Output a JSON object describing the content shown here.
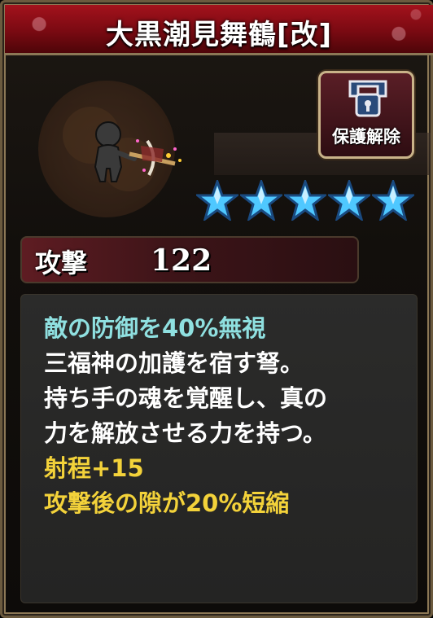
{
  "title": "大黒潮見舞鶴[改]",
  "protect_button": {
    "label": "保護解除",
    "icon": "lock-open-icon"
  },
  "rarity": {
    "stars": 5,
    "max": 5,
    "color": "#4fc8ff"
  },
  "attack": {
    "label": "攻撃",
    "value": "122"
  },
  "description": {
    "lines": [
      {
        "text": "敵の防御を40%無視",
        "color": "teal"
      },
      {
        "text": "三福神の加護を宿す弩。",
        "color": "white"
      },
      {
        "text": "持ち手の魂を覚醒し、真の",
        "color": "white"
      },
      {
        "text": "力を解放させる力を持つ。",
        "color": "white"
      },
      {
        "text": "射程+15",
        "color": "yellow"
      },
      {
        "text": "攻撃後の隙が20%短縮",
        "color": "yellow"
      }
    ]
  },
  "colors": {
    "title_bg": "#7a0a12",
    "frame": "#8c7856",
    "teal": "#8fe0e0",
    "yellow": "#f3d23a"
  }
}
